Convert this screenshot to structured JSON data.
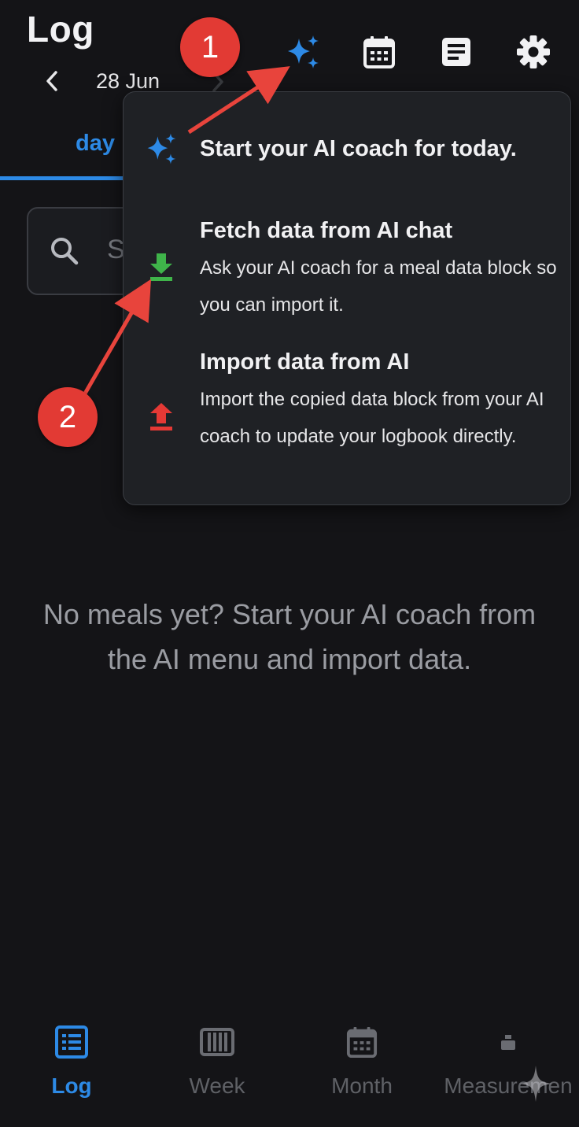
{
  "header": {
    "title": "Log",
    "date": "28 Jun",
    "icons": [
      "sparkle-icon",
      "calendar-icon",
      "notes-icon",
      "gear-icon"
    ]
  },
  "tabs": {
    "active": "day"
  },
  "search": {
    "placeholder": "S"
  },
  "ai_menu": {
    "items": [
      {
        "title": "Start your AI coach for today.",
        "icon": "sparkle-icon"
      },
      {
        "title": "Fetch data from AI chat",
        "description": "Ask your AI coach for a meal data block so you can import it.",
        "icon": "download-icon"
      },
      {
        "title": "Import data from AI",
        "description": "Import the copied data block from your AI coach to update your logbook directly.",
        "icon": "upload-icon"
      }
    ]
  },
  "empty_state": {
    "message": "No meals yet? Start your AI coach from the AI menu and import data."
  },
  "bottom_nav": [
    {
      "label": "Log",
      "icon": "list-icon",
      "active": true
    },
    {
      "label": "Week",
      "icon": "week-icon",
      "active": false
    },
    {
      "label": "Month",
      "icon": "calendar-icon",
      "active": false
    },
    {
      "label": "Measuremen",
      "icon": "measure-icon",
      "active": false
    }
  ],
  "annotations": {
    "badge1": "1",
    "badge2": "2"
  },
  "colors": {
    "accent": "#2d8ae6",
    "background": "#141417",
    "menu_bg": "#1f2125",
    "download": "#3fb44a",
    "upload": "#e53935",
    "annotation": "#e23a34"
  }
}
